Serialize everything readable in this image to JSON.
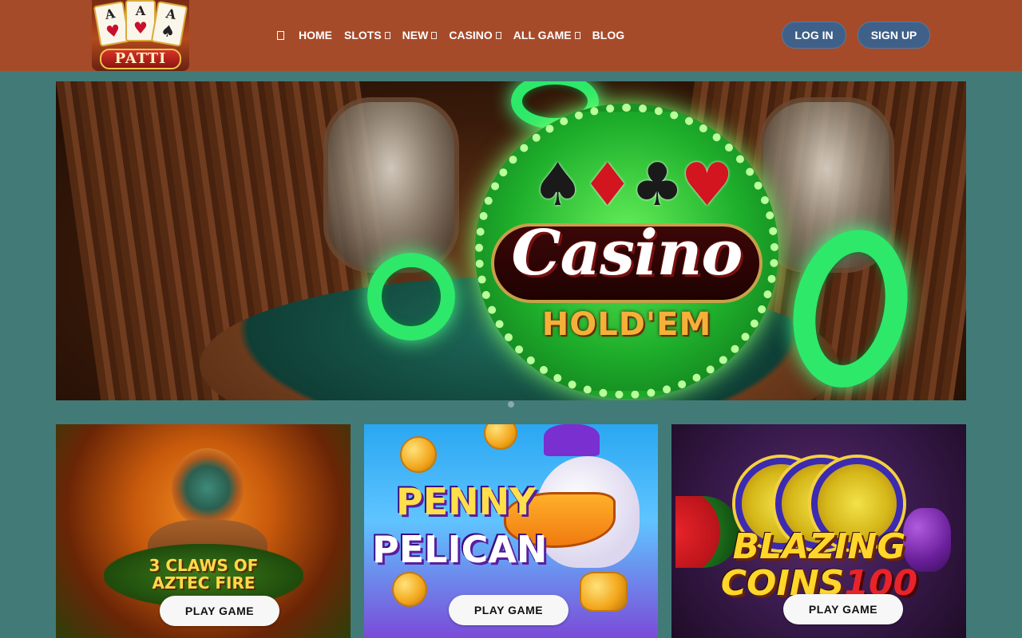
{
  "logo": {
    "text": "PATTI",
    "cards": [
      {
        "rank": "A",
        "suit": "♥"
      },
      {
        "rank": "A",
        "suit": "♥"
      },
      {
        "rank": "A",
        "suit": "♠"
      }
    ]
  },
  "nav": {
    "items": [
      {
        "label": "HOME",
        "has_dropdown": false
      },
      {
        "label": "SLOTS",
        "has_dropdown": true
      },
      {
        "label": "NEW",
        "has_dropdown": true
      },
      {
        "label": "CASINO",
        "has_dropdown": true
      },
      {
        "label": "ALL GAME",
        "has_dropdown": true
      },
      {
        "label": "BLOG",
        "has_dropdown": false
      }
    ]
  },
  "auth": {
    "login_label": "LOG IN",
    "signup_label": "SIGN UP"
  },
  "hero": {
    "title": "Casino",
    "subtitle": "HOLD'EM",
    "suits": [
      "♠",
      "♦",
      "♣",
      "♥"
    ]
  },
  "games": [
    {
      "title": "3 CLAWS OF AZTEC FIRE",
      "button_label": "PLAY GAME"
    },
    {
      "title_line1": "PENNY",
      "title_line2": "PELICAN",
      "button_label": "PLAY GAME"
    },
    {
      "title_line1": "BLAZING",
      "title_line2": "COINS",
      "title_number": "100",
      "button_label": "PLAY GAME"
    }
  ],
  "colors": {
    "header_bg": "#a64b2a",
    "page_bg": "#427a78",
    "auth_button": "#3f6189",
    "play_button": "#f7f7f7"
  }
}
